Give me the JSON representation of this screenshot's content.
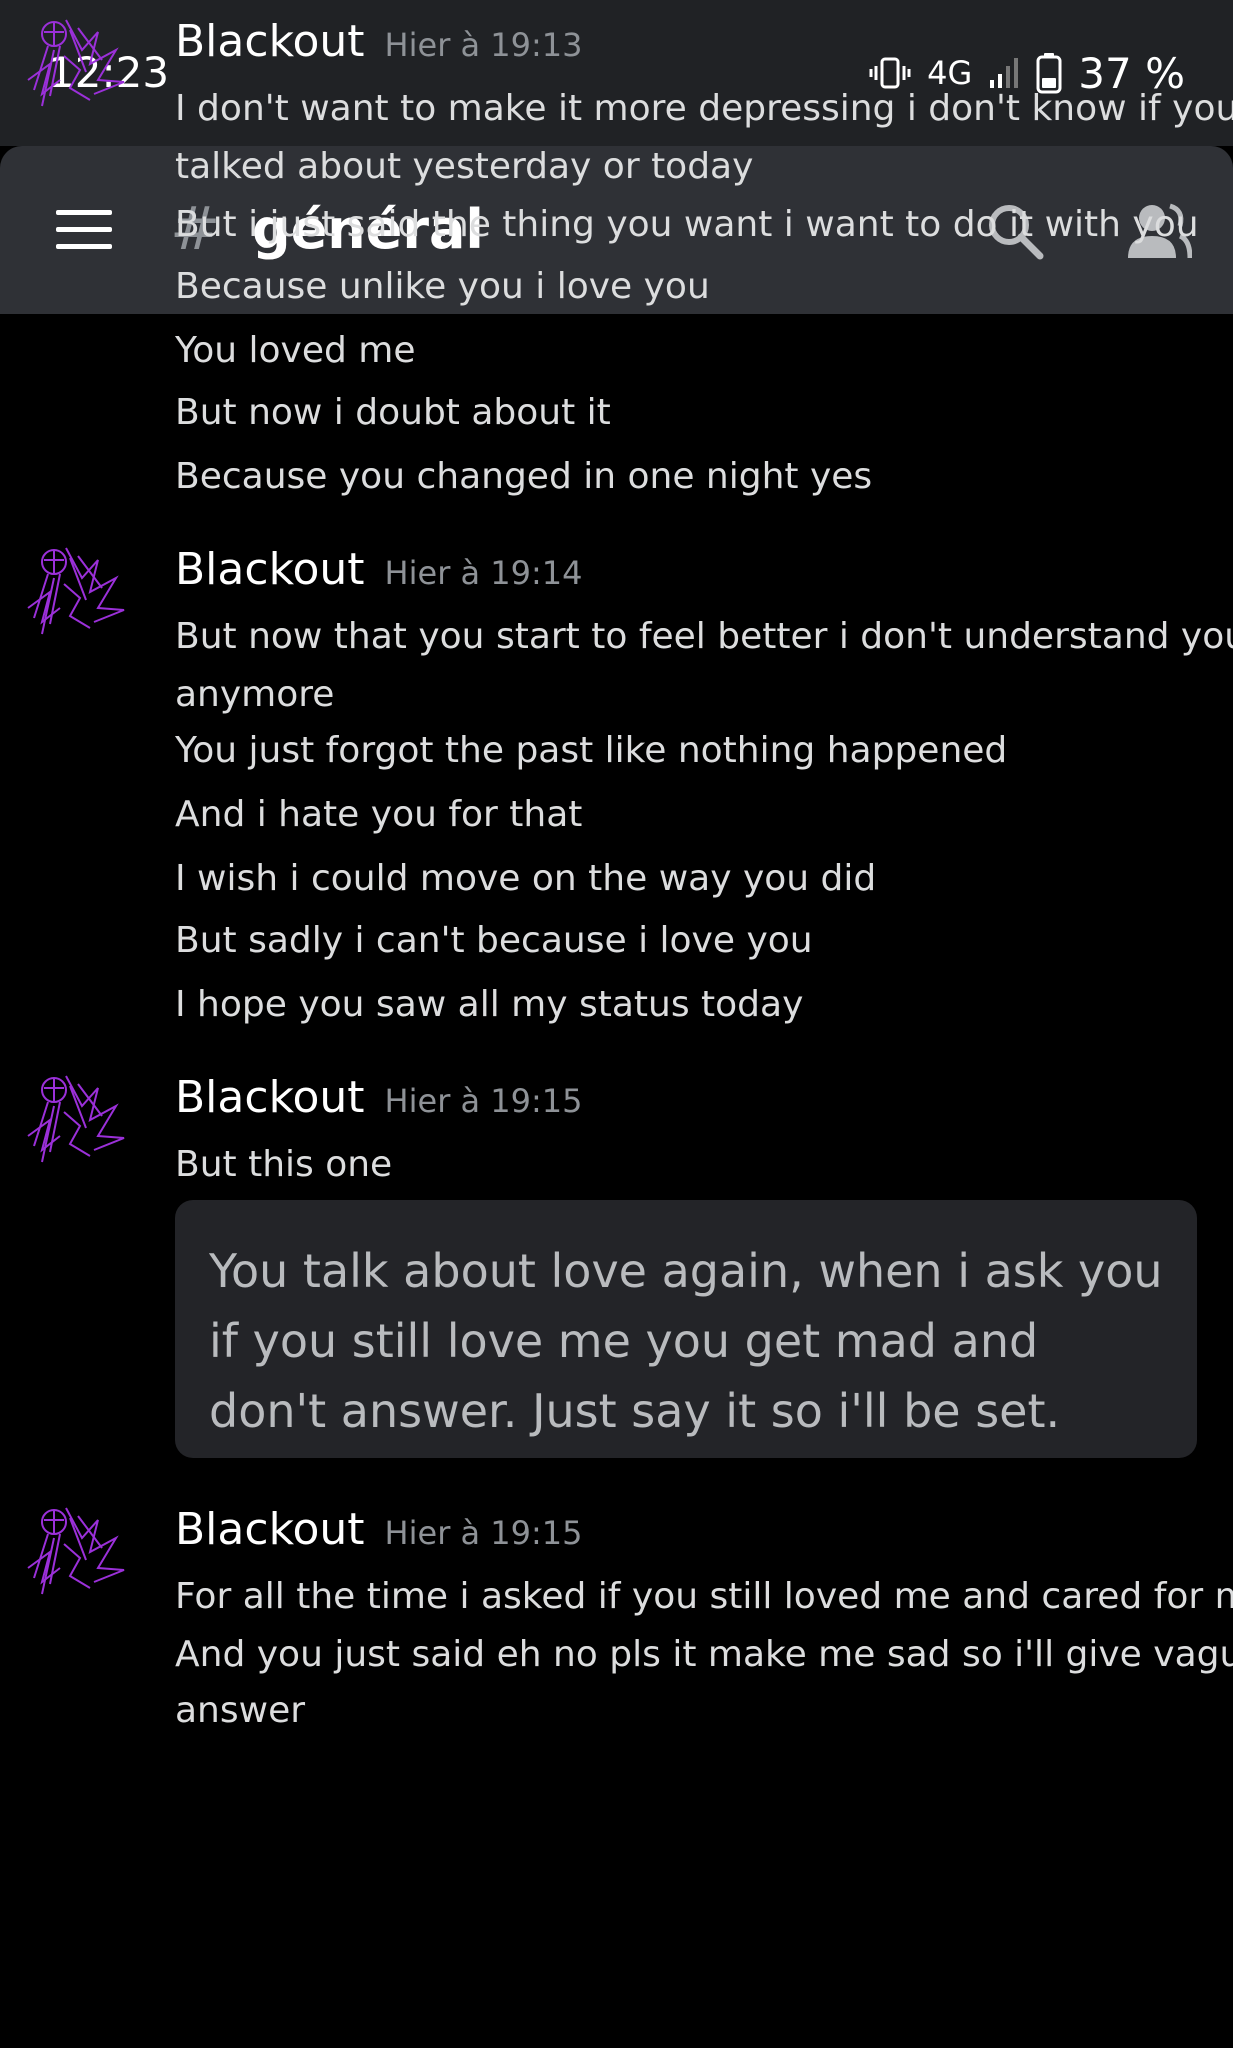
{
  "status_bar": {
    "time": "12:23",
    "network": "4G",
    "battery": "37 %"
  },
  "header": {
    "hash": "#",
    "channel": "général"
  },
  "icons": {
    "menu": "hamburger-icon",
    "search": "search-icon",
    "members": "members-icon",
    "vibrate": "vibrate-icon",
    "signal": "signal-icon",
    "battery": "battery-icon",
    "avatar": "purple-sketch-avatar"
  },
  "colors": {
    "background": "#000000",
    "header": "#2f3136",
    "avatar_accent": "#9b30d9"
  },
  "messages": [
    {
      "author": "Blackout",
      "time": "Hier à 19:13",
      "lines": [
        "I don't want to make it more depressing i don't know if you",
        "talked about yesterday or today",
        "But i just said the thing you want i want to do it with you",
        "Because unlike you i love you",
        "You loved me",
        "But now i doubt about it",
        "Because you changed in one night yes"
      ]
    },
    {
      "author": "Blackout",
      "time": "Hier à 19:14",
      "lines": [
        "But now that you start to feel better i don't understand you",
        "anymore",
        "You just forgot the past like nothing happened",
        "And i hate you for that",
        "I wish i could move on the way you did",
        "But sadly i can't because i love you",
        "I hope you saw all my status today"
      ]
    },
    {
      "author": "Blackout",
      "time": "Hier à 19:15",
      "lines": [
        "But this one"
      ],
      "quote": "You talk about love again, when i ask you if you still love me you get mad and don't answer. Just say it so i'll be set."
    },
    {
      "author": "Blackout",
      "time": "Hier à 19:15",
      "lines": [
        "For all the time i asked if you still loved me and cared for me",
        "And you just said eh no pls it make me sad so i'll give vague",
        "answer"
      ]
    }
  ]
}
